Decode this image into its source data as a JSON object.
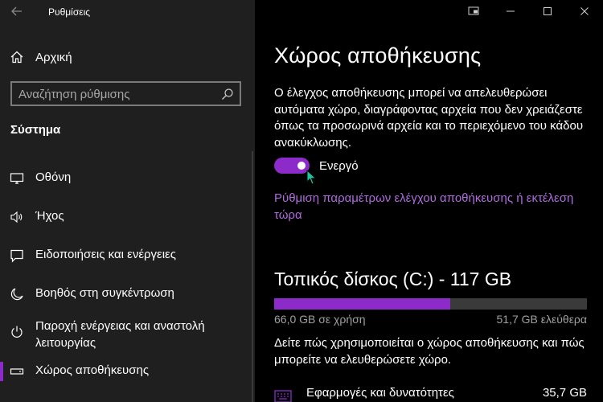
{
  "window": {
    "app_title": "Ρυθμίσεις"
  },
  "sidebar": {
    "home_label": "Αρχική",
    "search_placeholder": "Αναζήτηση ρύθμισης",
    "section_title": "Σύστημα",
    "items": [
      {
        "label": "Οθόνη",
        "icon": "display-icon"
      },
      {
        "label": "Ήχος",
        "icon": "speaker-icon"
      },
      {
        "label": "Ειδοποιήσεις και ενέργειες",
        "icon": "notification-icon"
      },
      {
        "label": "Βοηθός στη συγκέντρωση",
        "icon": "moon-icon"
      },
      {
        "label": "Παροχή ενέργειας και αναστολή λειτουργίας",
        "icon": "power-icon"
      },
      {
        "label": "Χώρος αποθήκευσης",
        "icon": "storage-icon",
        "selected": true
      }
    ]
  },
  "main": {
    "title": "Χώρος αποθήκευσης",
    "description": "Ο έλεγχος αποθήκευσης μπορεί να απελευθερώσει αυτόματα χώρο, διαγράφοντας αρχεία που δεν χρειάζεστε όπως τα προσωρινά αρχεία και το περιεχόμενο του κάδου ανακύκλωσης.",
    "toggle_label": "Ενεργό",
    "toggle_on": true,
    "link_text": "Ρύθμιση παραμέτρων ελέγχου αποθήκευσης ή εκτέλεση τώρα",
    "disk_title": "Τοπικός δίσκος (C:) - 117 GB",
    "disk_used_fraction": 0.564,
    "used_text": "66,0 GB σε χρήση",
    "free_text": "51,7 GB ελεύθερα",
    "disk_description": "Δείτε πώς χρησιμοποιείται ο χώρος αποθήκευσης και πώς μπορείτε να ελευθερώσετε χώρο.",
    "categories": [
      {
        "label": "Εφαρμογές και δυνατότητες",
        "size": "35,7 GB",
        "icon": "apps-icon"
      }
    ]
  },
  "colors": {
    "accent": "#8c2bc9",
    "link": "#b06bdf",
    "sidebar_bg": "#1f1f1f",
    "main_bg": "#000000"
  }
}
